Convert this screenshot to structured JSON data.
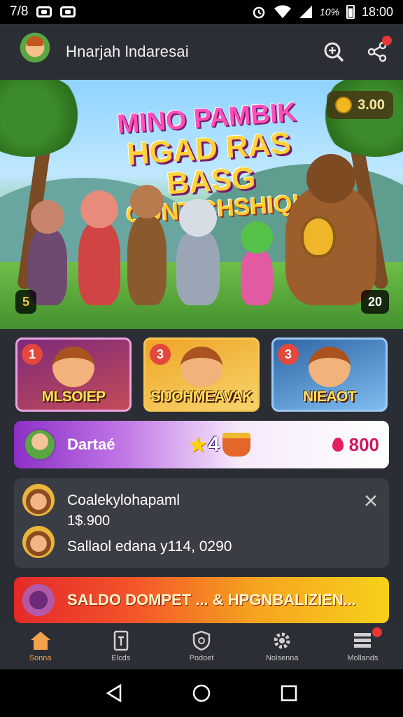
{
  "status_bar": {
    "time_left": "7/8",
    "battery_pct": "10%",
    "clock": "18:00"
  },
  "app": {
    "title": "Hnarjah lndaresai"
  },
  "hero": {
    "title_line1": "MINO PAMBIK",
    "title_line2": "HGAD RAS BASG",
    "title_line3": "CONT CHSHIQ!",
    "coin_balance": "3.00",
    "chip_left": "5",
    "chip_right": "20"
  },
  "categories": [
    {
      "number": "1",
      "label": "MLSOIEP"
    },
    {
      "number": "3",
      "label": "SIJOHMEAVAK"
    },
    {
      "number": "3",
      "label": "NIEAOT"
    }
  ],
  "rewards": {
    "label": "Dartaé",
    "count": "4",
    "value": "800"
  },
  "transaction": {
    "title": "Coalekylohapaml",
    "amount": "1$.900",
    "subtitle": "Sallaol edana y114, 0290"
  },
  "promo": {
    "text": "SALDO DOMPET ... & HPGNBALIZIEN..."
  },
  "bottom_nav": [
    {
      "label": "Sonna",
      "icon": "home-icon",
      "active": true
    },
    {
      "label": "Elcds",
      "icon": "document-icon",
      "active": false
    },
    {
      "label": "Podoet",
      "icon": "shield-icon",
      "active": false
    },
    {
      "label": "Nolsenna",
      "icon": "gear-icon",
      "active": false
    },
    {
      "label": "Mollands",
      "icon": "list-icon",
      "active": false
    }
  ],
  "colors": {
    "accent_orange": "#f2a24a",
    "badge_red": "#e53935",
    "reward_purple": "#8c2fc7",
    "gem_pink": "#d0185f"
  }
}
